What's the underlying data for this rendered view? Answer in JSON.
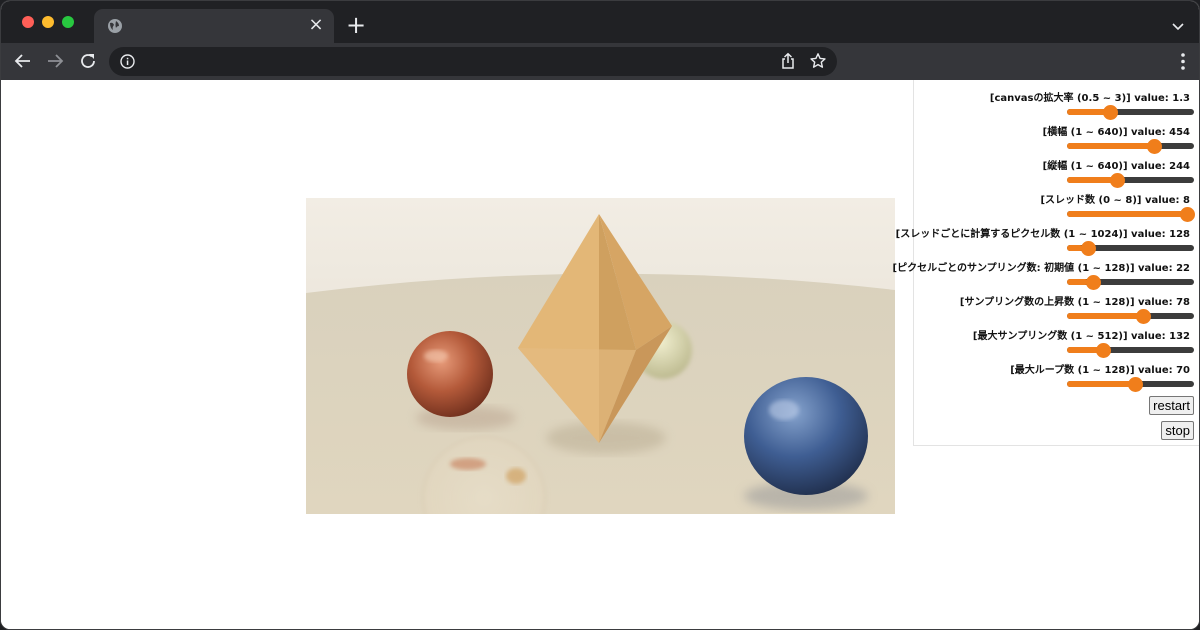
{
  "browser": {
    "tab": {
      "title": "",
      "close_glyph": "×",
      "icon": "globe-icon"
    },
    "new_tab_glyph": "+",
    "address": ""
  },
  "colors": {
    "accent": "#f07e1b",
    "track": "#3c3c3c",
    "chrome_dark": "#202124",
    "chrome_mid": "#35363a"
  },
  "controls": [
    {
      "label": "[canvasの拡大率 (0.5 ~ 3)] value: 1.3",
      "min": 0.5,
      "max": 3,
      "value": 1.3
    },
    {
      "label": "[横幅 (1 ~ 640)] value: 454",
      "min": 1,
      "max": 640,
      "value": 454
    },
    {
      "label": "[縦幅 (1 ~ 640)] value: 244",
      "min": 1,
      "max": 640,
      "value": 244
    },
    {
      "label": "[スレッド数 (0 ~ 8)] value: 8",
      "min": 0,
      "max": 8,
      "value": 8
    },
    {
      "label": "[スレッドごとに計算するピクセル数 (1 ~ 1024)] value: 128",
      "min": 1,
      "max": 1024,
      "value": 128
    },
    {
      "label": "[ピクセルごとのサンプリング数: 初期値 (1 ~ 128)] value: 22",
      "min": 1,
      "max": 128,
      "value": 22
    },
    {
      "label": "[サンプリング数の上昇数 (1 ~ 128)] value: 78",
      "min": 1,
      "max": 128,
      "value": 78
    },
    {
      "label": "[最大サンプリング数 (1 ~ 512)] value: 132",
      "min": 1,
      "max": 512,
      "value": 132
    },
    {
      "label": "[最大ループ数 (1 ~ 128)] value: 70",
      "min": 1,
      "max": 128,
      "value": 70
    }
  ],
  "buttons": {
    "restart": "restart",
    "stop": "stop"
  }
}
